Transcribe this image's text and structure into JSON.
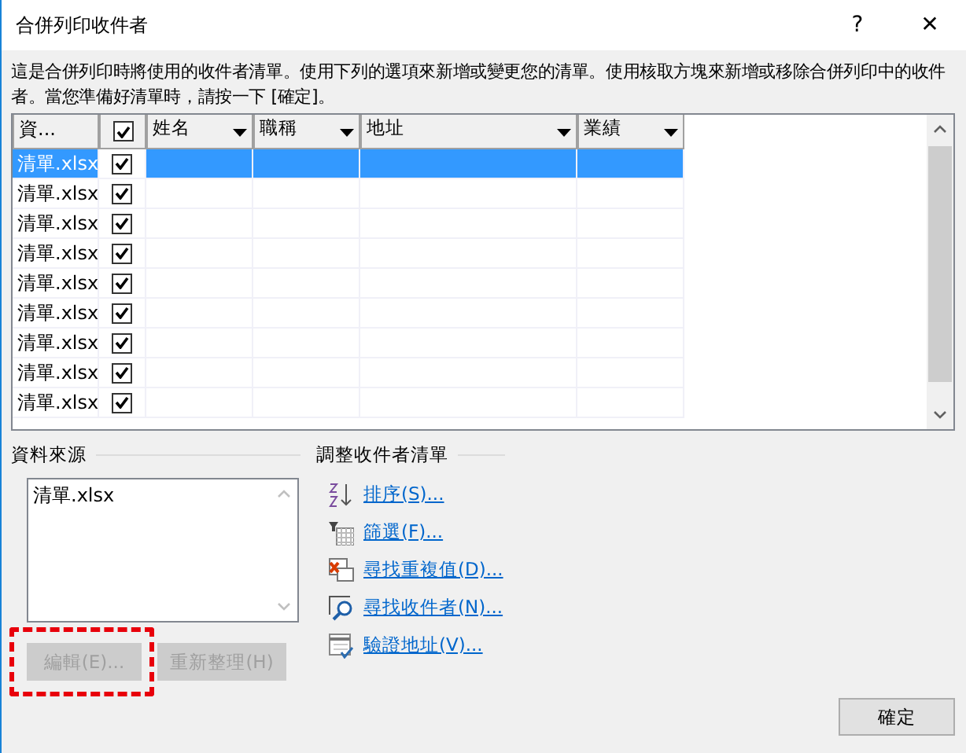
{
  "window": {
    "title": "合併列印收件者",
    "help": "?",
    "close": "✕"
  },
  "description": "這是合併列印時將使用的收件者清單。使用下列的選項來新增或變更您的清單。使用核取方塊來新增或移除合併列印中的收件者。當您準備好清單時，請按一下 [確定]。",
  "table": {
    "columns": [
      {
        "kind": "source",
        "label": "資..."
      },
      {
        "kind": "check",
        "checked": true
      },
      {
        "kind": "field",
        "label": "姓名"
      },
      {
        "kind": "field",
        "label": "職稱"
      },
      {
        "kind": "field",
        "label": "地址"
      },
      {
        "kind": "field",
        "label": "業績"
      }
    ],
    "rows": [
      {
        "source": "清單.xlsx",
        "checked": true,
        "selected": true
      },
      {
        "source": "清單.xlsx",
        "checked": true,
        "selected": false
      },
      {
        "source": "清單.xlsx",
        "checked": true,
        "selected": false
      },
      {
        "source": "清單.xlsx",
        "checked": true,
        "selected": false
      },
      {
        "source": "清單.xlsx",
        "checked": true,
        "selected": false
      },
      {
        "source": "清單.xlsx",
        "checked": true,
        "selected": false
      },
      {
        "source": "清單.xlsx",
        "checked": true,
        "selected": false
      },
      {
        "source": "清單.xlsx",
        "checked": true,
        "selected": false
      },
      {
        "source": "清單.xlsx",
        "checked": true,
        "selected": false
      }
    ]
  },
  "data_source": {
    "heading": "資料來源",
    "items": [
      {
        "label": "清單.xlsx"
      }
    ],
    "buttons": [
      {
        "label": "編輯(E)...",
        "disabled": true,
        "highlighted": true
      },
      {
        "label": "重新整理(H)",
        "disabled": true,
        "highlighted": false
      }
    ]
  },
  "refine": {
    "heading": "調整收件者清單",
    "links": [
      {
        "kind": "sort",
        "label": "排序(S)..."
      },
      {
        "kind": "filter",
        "label": "篩選(F)..."
      },
      {
        "kind": "duplicates",
        "label": "尋找重複值(D)..."
      },
      {
        "kind": "find",
        "label": "尋找收件者(N)..."
      },
      {
        "kind": "validate",
        "label": "驗證地址(V)..."
      }
    ]
  },
  "ok_button": "確定"
}
